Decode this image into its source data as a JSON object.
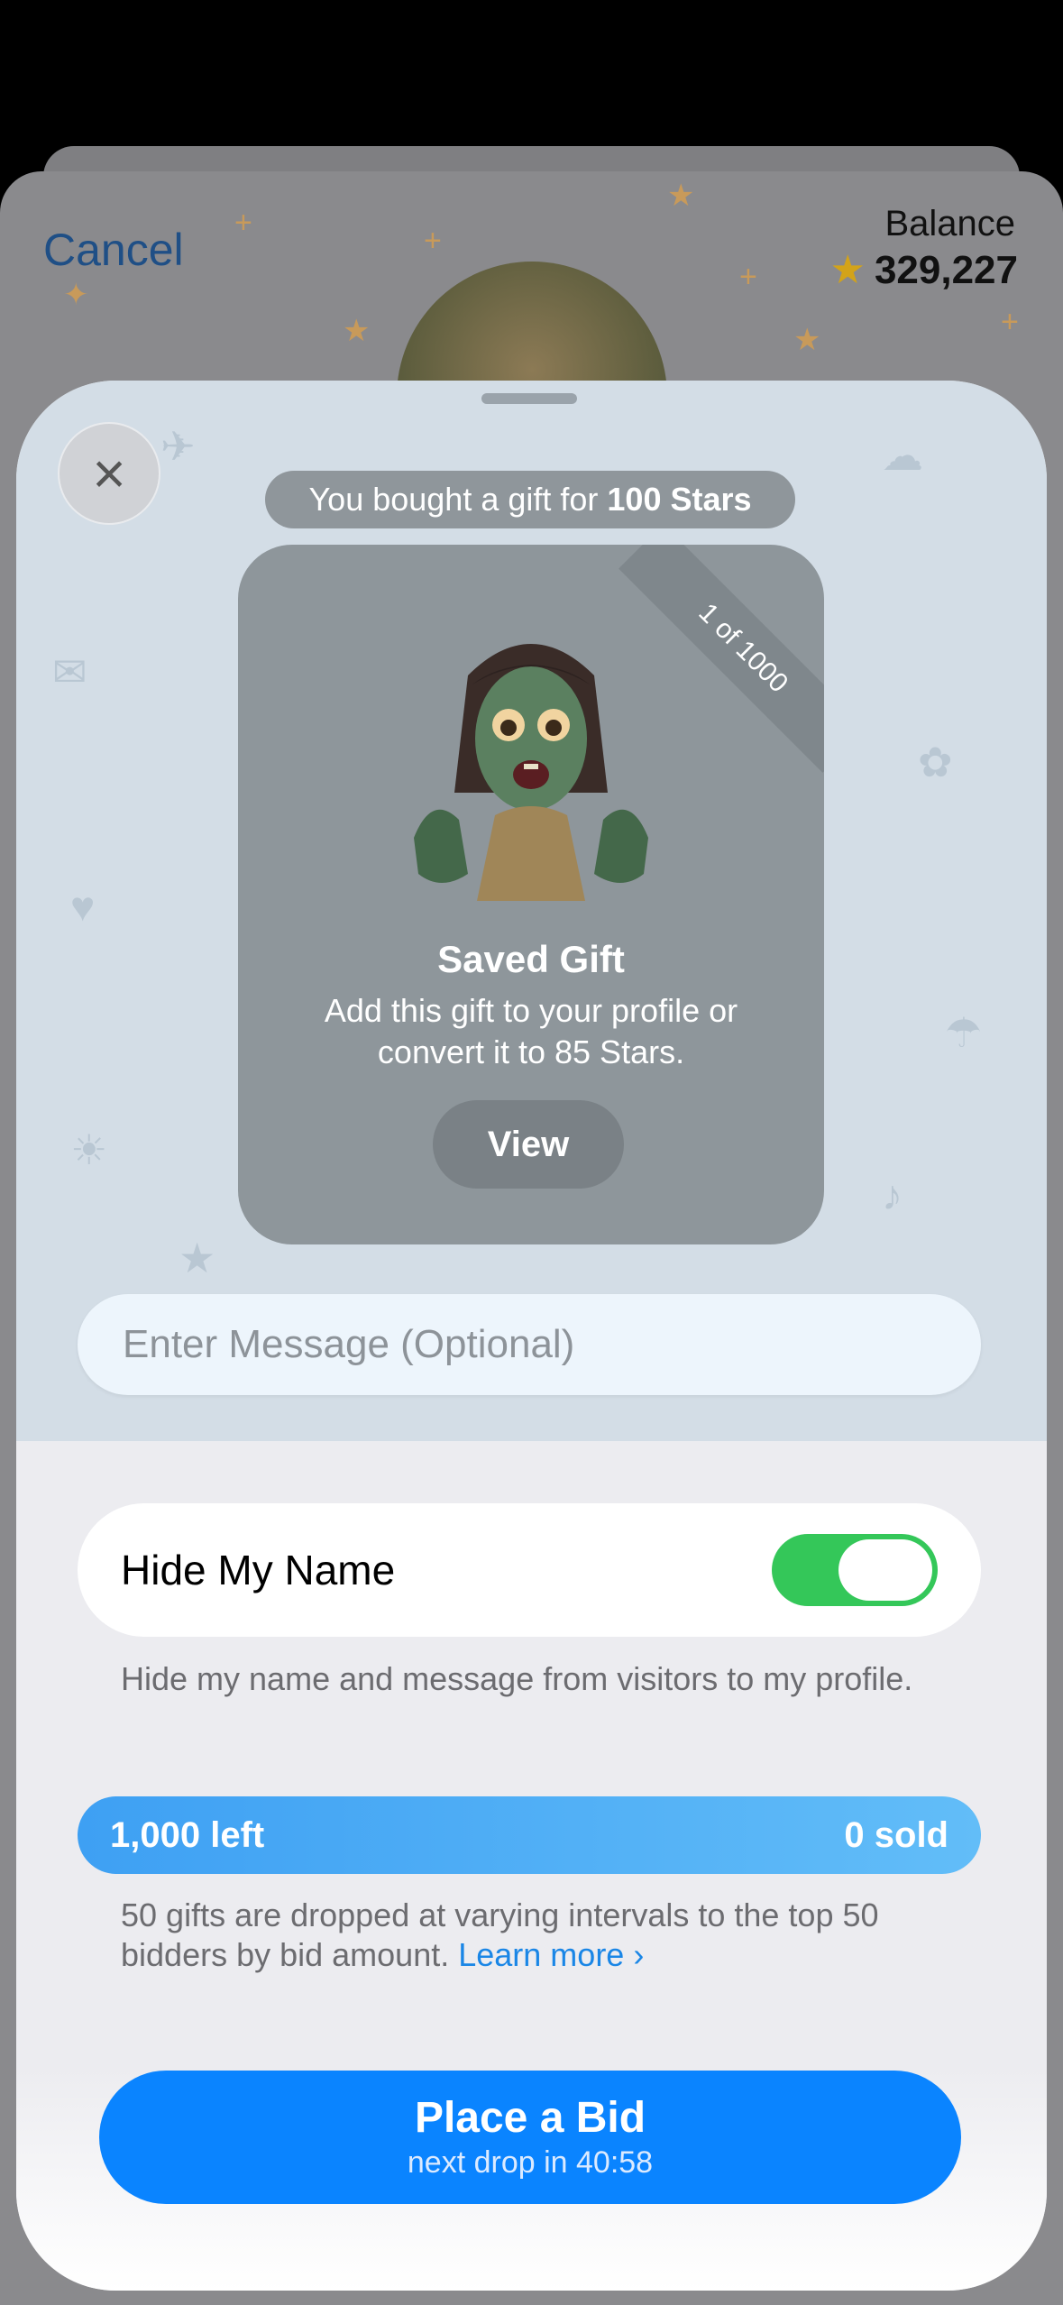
{
  "background": {
    "cancel_label": "Cancel",
    "balance_label": "Balance",
    "balance_value": "329,227"
  },
  "modal": {
    "close_icon": "close-icon",
    "bought_prefix": "You bought a gift for",
    "bought_amount": "100 Stars",
    "gift": {
      "ribbon": "1 of 1000",
      "title": "Saved Gift",
      "description": "Add this gift to your profile or convert it to 85 Stars.",
      "view_label": "View"
    },
    "message_placeholder": "Enter Message (Optional)",
    "hide_name": {
      "label": "Hide My Name",
      "enabled": true,
      "description": "Hide my name and message from visitors to my profile."
    },
    "availability": {
      "left": "1,000 left",
      "sold": "0 sold",
      "sold_fraction": 0
    },
    "drop_info": "50 gifts are dropped at varying intervals to the top 50 bidders by bid amount.",
    "learn_more": "Learn more ›",
    "bid_button": {
      "label": "Place a Bid",
      "subtitle": "next drop in 40:58"
    }
  },
  "colors": {
    "accent": "#0a84ff",
    "toggle_on": "#34c759",
    "star": "#d3a319"
  }
}
